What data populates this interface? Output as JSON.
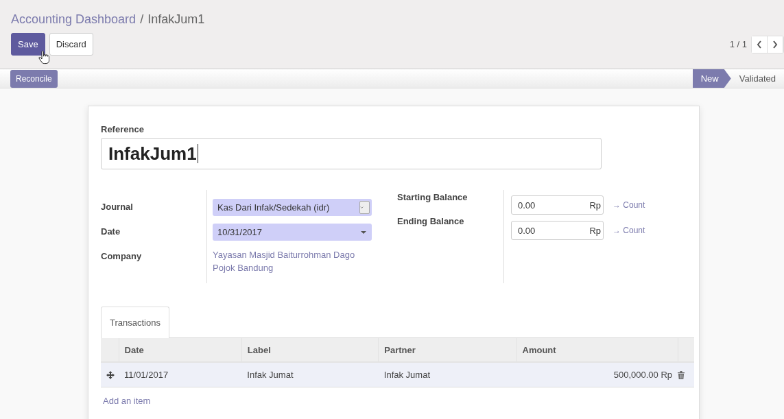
{
  "breadcrumb": [
    {
      "label": "Accounting Dashboard",
      "kind": "link"
    },
    {
      "label": "InfakJum1",
      "kind": "current"
    }
  ],
  "breadcrumb_separator": "/",
  "buttons": [
    {
      "label": "Save",
      "kind": "primary"
    },
    {
      "label": "Discard",
      "kind": "secondary"
    }
  ],
  "pager": {
    "value": "1 / 1"
  },
  "header_buttons": [
    {
      "label": "Reconcile"
    }
  ],
  "status_steps": [
    {
      "label": "New",
      "selected": true
    },
    {
      "label": "Validated",
      "selected": false
    }
  ],
  "form": {
    "reference": {
      "label": "Reference",
      "value": "InfakJum1"
    },
    "left_fields": [
      {
        "label": "Journal",
        "kind": "select",
        "value": "Kas Dari Infak/Sedekah (idr)"
      },
      {
        "label": "Date",
        "kind": "date",
        "value": "10/31/2017"
      },
      {
        "label": "Company",
        "kind": "link",
        "value": "Yayasan Masjid Baiturrohman Dago Pojok Bandung"
      }
    ],
    "right_fields": [
      {
        "label": "Starting Balance",
        "value": "0.00",
        "currency": "Rp",
        "action": "→ Count"
      },
      {
        "label": "Ending Balance",
        "value": "0.00",
        "currency": "Rp",
        "action": "→ Count"
      }
    ]
  },
  "tabs": [
    {
      "label": "Transactions",
      "selected": true
    }
  ],
  "table": {
    "columns": [
      "Date",
      "Label",
      "Partner",
      "Amount"
    ],
    "rows": [
      {
        "cells": [
          "11/01/2017",
          "Infak Jumat",
          "Infak Jumat",
          "500,000.00 Rp"
        ]
      }
    ],
    "add_link": "Add an item"
  }
}
